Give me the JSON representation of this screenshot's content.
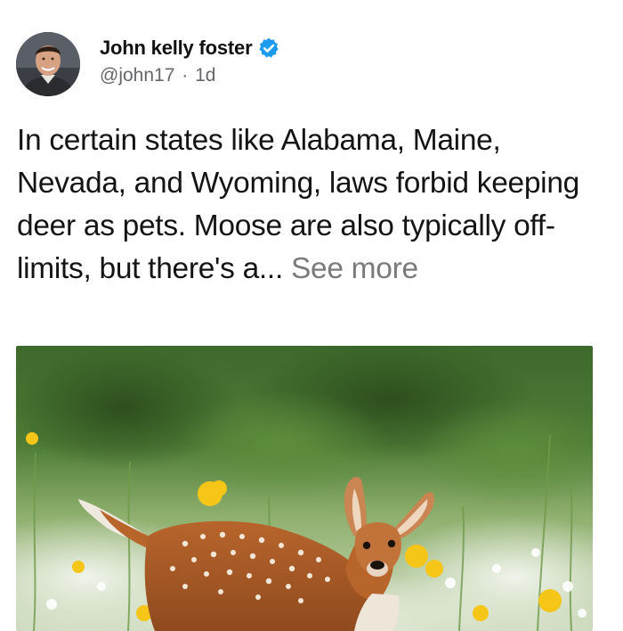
{
  "post": {
    "author": {
      "name": "John kelly foster",
      "handle": "@john17",
      "separator": "·",
      "time": "1d",
      "verified": true,
      "avatar_icon": "profile-photo"
    },
    "text": "In certain states like Alabama, Maine, Nevada, and Wyoming, laws forbid keeping deer as pets. Moose are also typically off-limits, but there's a...",
    "see_more_label": "See more",
    "media": {
      "type": "photo",
      "icon": "fawn-in-meadow-photo"
    }
  },
  "colors": {
    "verified_badge": "#1d9bf0",
    "secondary_text": "#65676b",
    "see_more": "#7a7a7a"
  }
}
